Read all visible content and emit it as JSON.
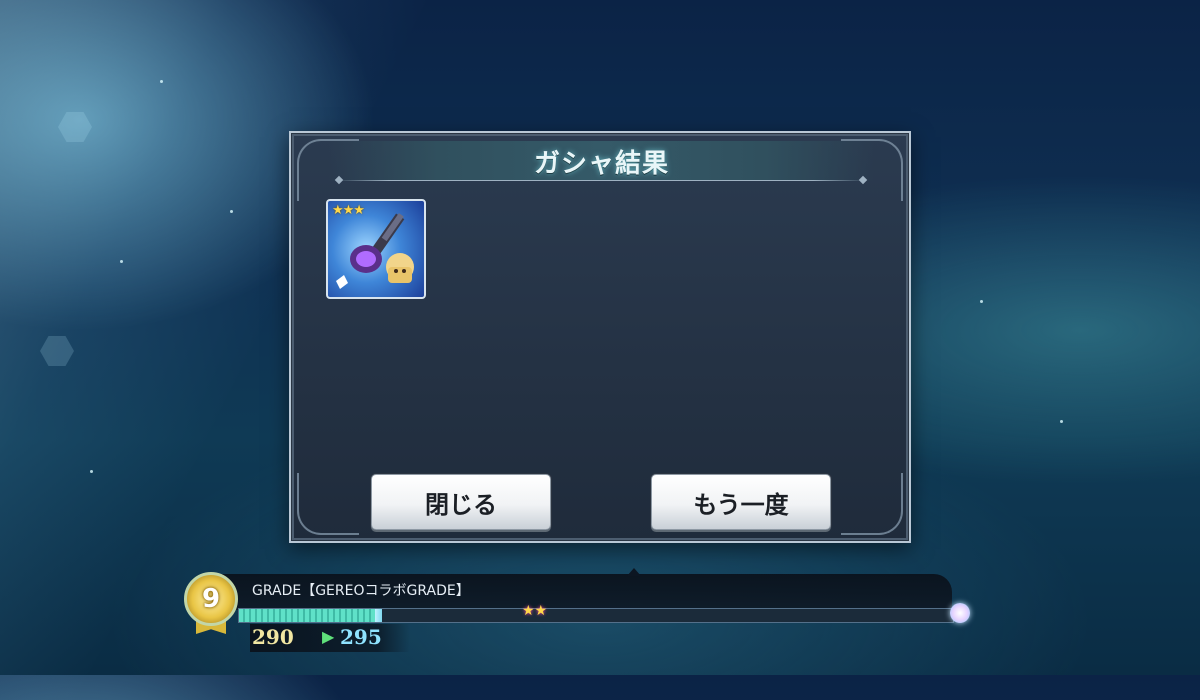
{
  "dialog": {
    "title": "ガシャ結果",
    "item": {
      "rarity_stars": "★★★",
      "icon": "weapon-staff-icon"
    },
    "close_label": "閉じる",
    "again_label": "もう一度"
  },
  "grade": {
    "label": "GRADE【GEREOコラボGRADE】",
    "level_badge": "9",
    "score_before": "290",
    "arrow": "▶",
    "score_after": "295",
    "progress_before": 0.19,
    "progress_after": 0.2
  },
  "colors": {
    "title_glow": "#78dce6",
    "progress_fill": "#5fe1c8",
    "score_before": "#f1e6a2",
    "score_after": "#8fe3ff"
  }
}
